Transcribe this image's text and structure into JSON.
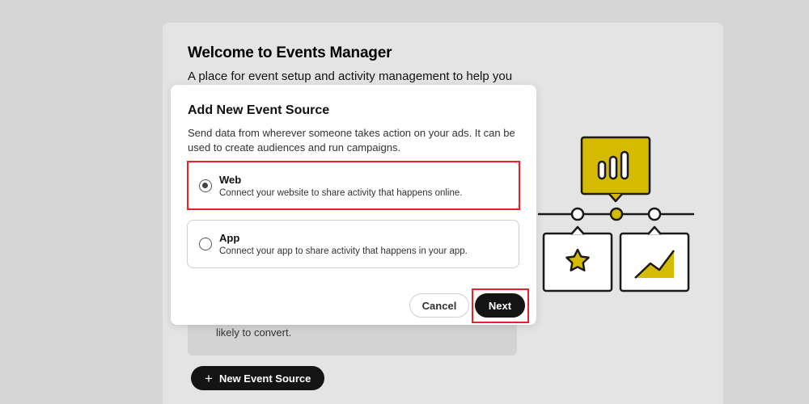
{
  "page": {
    "title": "Welcome to Events Manager",
    "subtitle": "A place for event setup and activity management to help you",
    "panel_text": "likely to convert.",
    "new_event_source_label": "New Event Source",
    "new_event_source_icon": "plus-icon"
  },
  "modal": {
    "title": "Add New Event Source",
    "description": "Send data from wherever someone takes action on your ads. It can be used to create audiences and run campaigns.",
    "options": [
      {
        "label": "Web",
        "description": "Connect your website to share activity that happens online.",
        "selected": true
      },
      {
        "label": "App",
        "description": "Connect your app to share activity that happens in your app.",
        "selected": false
      }
    ],
    "cancel_label": "Cancel",
    "next_label": "Next"
  },
  "colors": {
    "accent_yellow": "#d4ba00",
    "highlight_red": "#e8212a",
    "primary_button": "#141414"
  }
}
